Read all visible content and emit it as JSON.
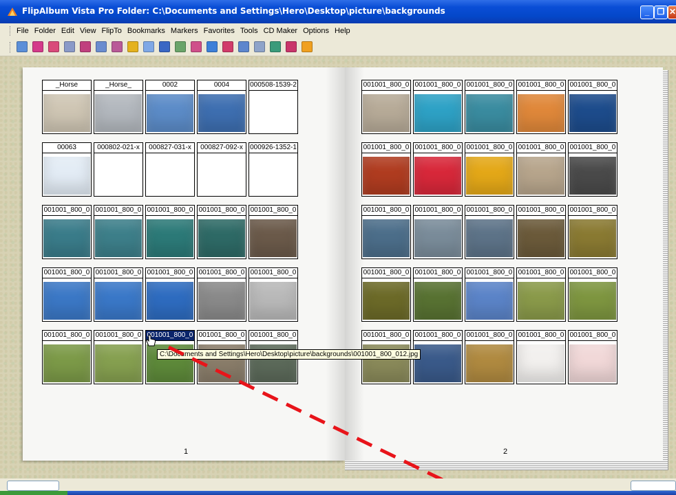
{
  "window": {
    "title": "FlipAlbum Vista Pro    Folder: C:\\Documents and Settings\\Hero\\Desktop\\picture\\backgrounds",
    "controls": [
      "minimize",
      "restore",
      "close"
    ]
  },
  "menu": {
    "items": [
      "File",
      "Folder",
      "Edit",
      "View",
      "FlipTo",
      "Bookmarks",
      "Markers",
      "Favorites",
      "Tools",
      "CD Maker",
      "Options",
      "Help"
    ]
  },
  "toolbar": {
    "tools": [
      {
        "name": "view-icon",
        "color": "#5b8fd8"
      },
      {
        "name": "bookmark-icon",
        "color": "#d43a8a"
      },
      {
        "name": "open-book-icon",
        "color": "#d94a7a"
      },
      {
        "name": "page-icon",
        "color": "#8a9ac8"
      },
      {
        "name": "flip-icon",
        "color": "#c0407e"
      },
      {
        "name": "pages-icon",
        "color": "#6a8ccf"
      },
      {
        "name": "contents-icon",
        "color": "#b95a98"
      },
      {
        "name": "add-icon",
        "color": "#e4b21e"
      },
      {
        "name": "arrow-icon",
        "color": "#7fa8e6"
      },
      {
        "name": "columns-icon",
        "color": "#3a67c4"
      },
      {
        "name": "edit-icon",
        "color": "#6aa46a"
      },
      {
        "name": "film-icon",
        "color": "#cf4f8a"
      },
      {
        "name": "zoom-icon",
        "color": "#3d7fd8"
      },
      {
        "name": "slideshow-icon",
        "color": "#d13b6a"
      },
      {
        "name": "screen-icon",
        "color": "#5d86cd"
      },
      {
        "name": "print-icon",
        "color": "#8ea3c9"
      },
      {
        "name": "home-icon",
        "color": "#3a9b7a"
      },
      {
        "name": "pointer-icon",
        "color": "#c9356a"
      },
      {
        "name": "help-icon",
        "color": "#f0a020"
      }
    ]
  },
  "book": {
    "left_page_number": "1",
    "right_page_number": "2",
    "left_page": [
      {
        "label": "_Horse",
        "color": "#cfc6b4"
      },
      {
        "label": "_Horse_",
        "color": "#b3b8be"
      },
      {
        "label": "0002",
        "color": "#5c8cc8"
      },
      {
        "label": "0004",
        "color": "#3e6fb1"
      },
      {
        "label": "000508-1539-2",
        "color": ""
      },
      {
        "label": "00063",
        "color": "#e3ecf5"
      },
      {
        "label": "000802-021-x",
        "color": ""
      },
      {
        "label": "000827-031-x",
        "color": ""
      },
      {
        "label": "000827-092-x",
        "color": ""
      },
      {
        "label": "000926-1352-1",
        "color": ""
      },
      {
        "label": "001001_800_0",
        "color": "#3a7c8a"
      },
      {
        "label": "001001_800_0",
        "color": "#3d7f8a"
      },
      {
        "label": "001001_800_0",
        "color": "#2c7a78"
      },
      {
        "label": "001001_800_0",
        "color": "#2e6a66"
      },
      {
        "label": "001001_800_0",
        "color": "#6b5a4a"
      },
      {
        "label": "001001_800_0",
        "color": "#3b78c6"
      },
      {
        "label": "001001_800_0",
        "color": "#3a78c8"
      },
      {
        "label": "001001_800_0",
        "color": "#2e6cc0"
      },
      {
        "label": "001001_800_0",
        "color": "#8a8a8a"
      },
      {
        "label": "001001_800_0",
        "color": "#b9b9b9"
      },
      {
        "label": "001001_800_0",
        "color": "#7c9a48"
      },
      {
        "label": "001001_800_0",
        "color": "#86a050"
      },
      {
        "label": "001001_800_0",
        "color": "#5e8a3a",
        "selected": true
      },
      {
        "label": "001001_800_0",
        "color": "#8a7d6a"
      },
      {
        "label": "001001_800_0",
        "color": "#5c6a5a"
      }
    ],
    "right_page": [
      {
        "label": "001001_800_0",
        "color": "#b7ab98"
      },
      {
        "label": "001001_800_0",
        "color": "#2ea2c6"
      },
      {
        "label": "001001_800_0",
        "color": "#3a8ca0"
      },
      {
        "label": "001001_800_0",
        "color": "#e0883a"
      },
      {
        "label": "001001_800_0",
        "color": "#1d4c8c"
      },
      {
        "label": "001001_800_0",
        "color": "#b03c20"
      },
      {
        "label": "001001_800_0",
        "color": "#d8283a"
      },
      {
        "label": "001001_800_0",
        "color": "#e4a818"
      },
      {
        "label": "001001_800_0",
        "color": "#b7a58c"
      },
      {
        "label": "001001_800_0",
        "color": "#4a4a4a"
      },
      {
        "label": "001001_800_0",
        "color": "#4c6e8a"
      },
      {
        "label": "001001_800_0",
        "color": "#7a8c9a"
      },
      {
        "label": "001001_800_0",
        "color": "#5d7388"
      },
      {
        "label": "001001_800_0",
        "color": "#6b5a3a"
      },
      {
        "label": "001001_800_0",
        "color": "#8a7a32"
      },
      {
        "label": "001001_800_0",
        "color": "#6c6a28"
      },
      {
        "label": "001001_800_0",
        "color": "#587232"
      },
      {
        "label": "001001_800_0",
        "color": "#5b84c8"
      },
      {
        "label": "001001_800_0",
        "color": "#8a9a4a"
      },
      {
        "label": "001001_800_0",
        "color": "#7e9640"
      },
      {
        "label": "001001_800_0",
        "color": "#8a8a5a"
      },
      {
        "label": "001001_800_0",
        "color": "#3a5a8a"
      },
      {
        "label": "001001_800_0",
        "color": "#b08a40"
      },
      {
        "label": "001001_800_0",
        "color": "#f2f0ee"
      },
      {
        "label": "001001_800_0",
        "color": "#f1d8d8"
      }
    ]
  },
  "tooltip": {
    "text": "C:\\Documents and Settings\\Hero\\Desktop\\picture\\backgrounds\\001001_800_012.jpg"
  },
  "accent": {
    "arrow_color": "#e8141a"
  }
}
